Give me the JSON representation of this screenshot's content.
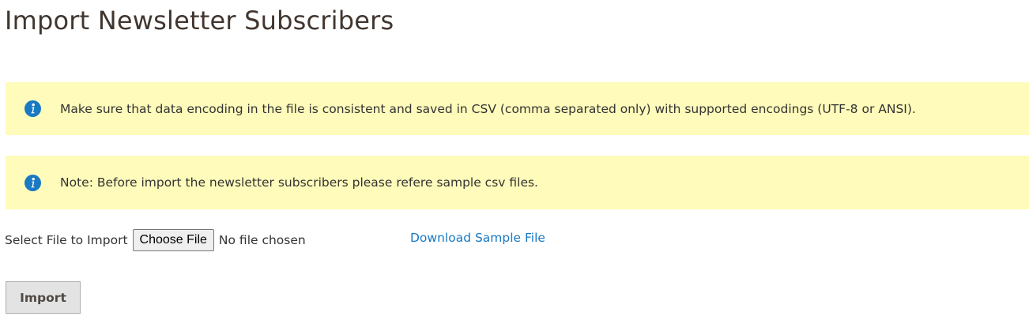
{
  "page": {
    "title": "Import Newsletter Subscribers"
  },
  "notices": [
    {
      "icon": "info-icon",
      "text": "Make sure that data encoding in the file is consistent and saved in CSV (comma separated only) with supported encodings (UTF-8 or ANSI)."
    },
    {
      "icon": "info-icon",
      "text": "Note: Before import the newsletter subscribers please refere sample csv files."
    }
  ],
  "file_input": {
    "label": "Select File to Import",
    "button_label": "Choose File",
    "status": "No file chosen"
  },
  "download_link": {
    "label": "Download Sample File"
  },
  "actions": {
    "import_label": "Import"
  },
  "colors": {
    "notice_background": "#fffbbb",
    "info_icon": "#1979c3",
    "link": "#1979c3",
    "title": "#41362f",
    "button_background": "#e3e3e3"
  }
}
